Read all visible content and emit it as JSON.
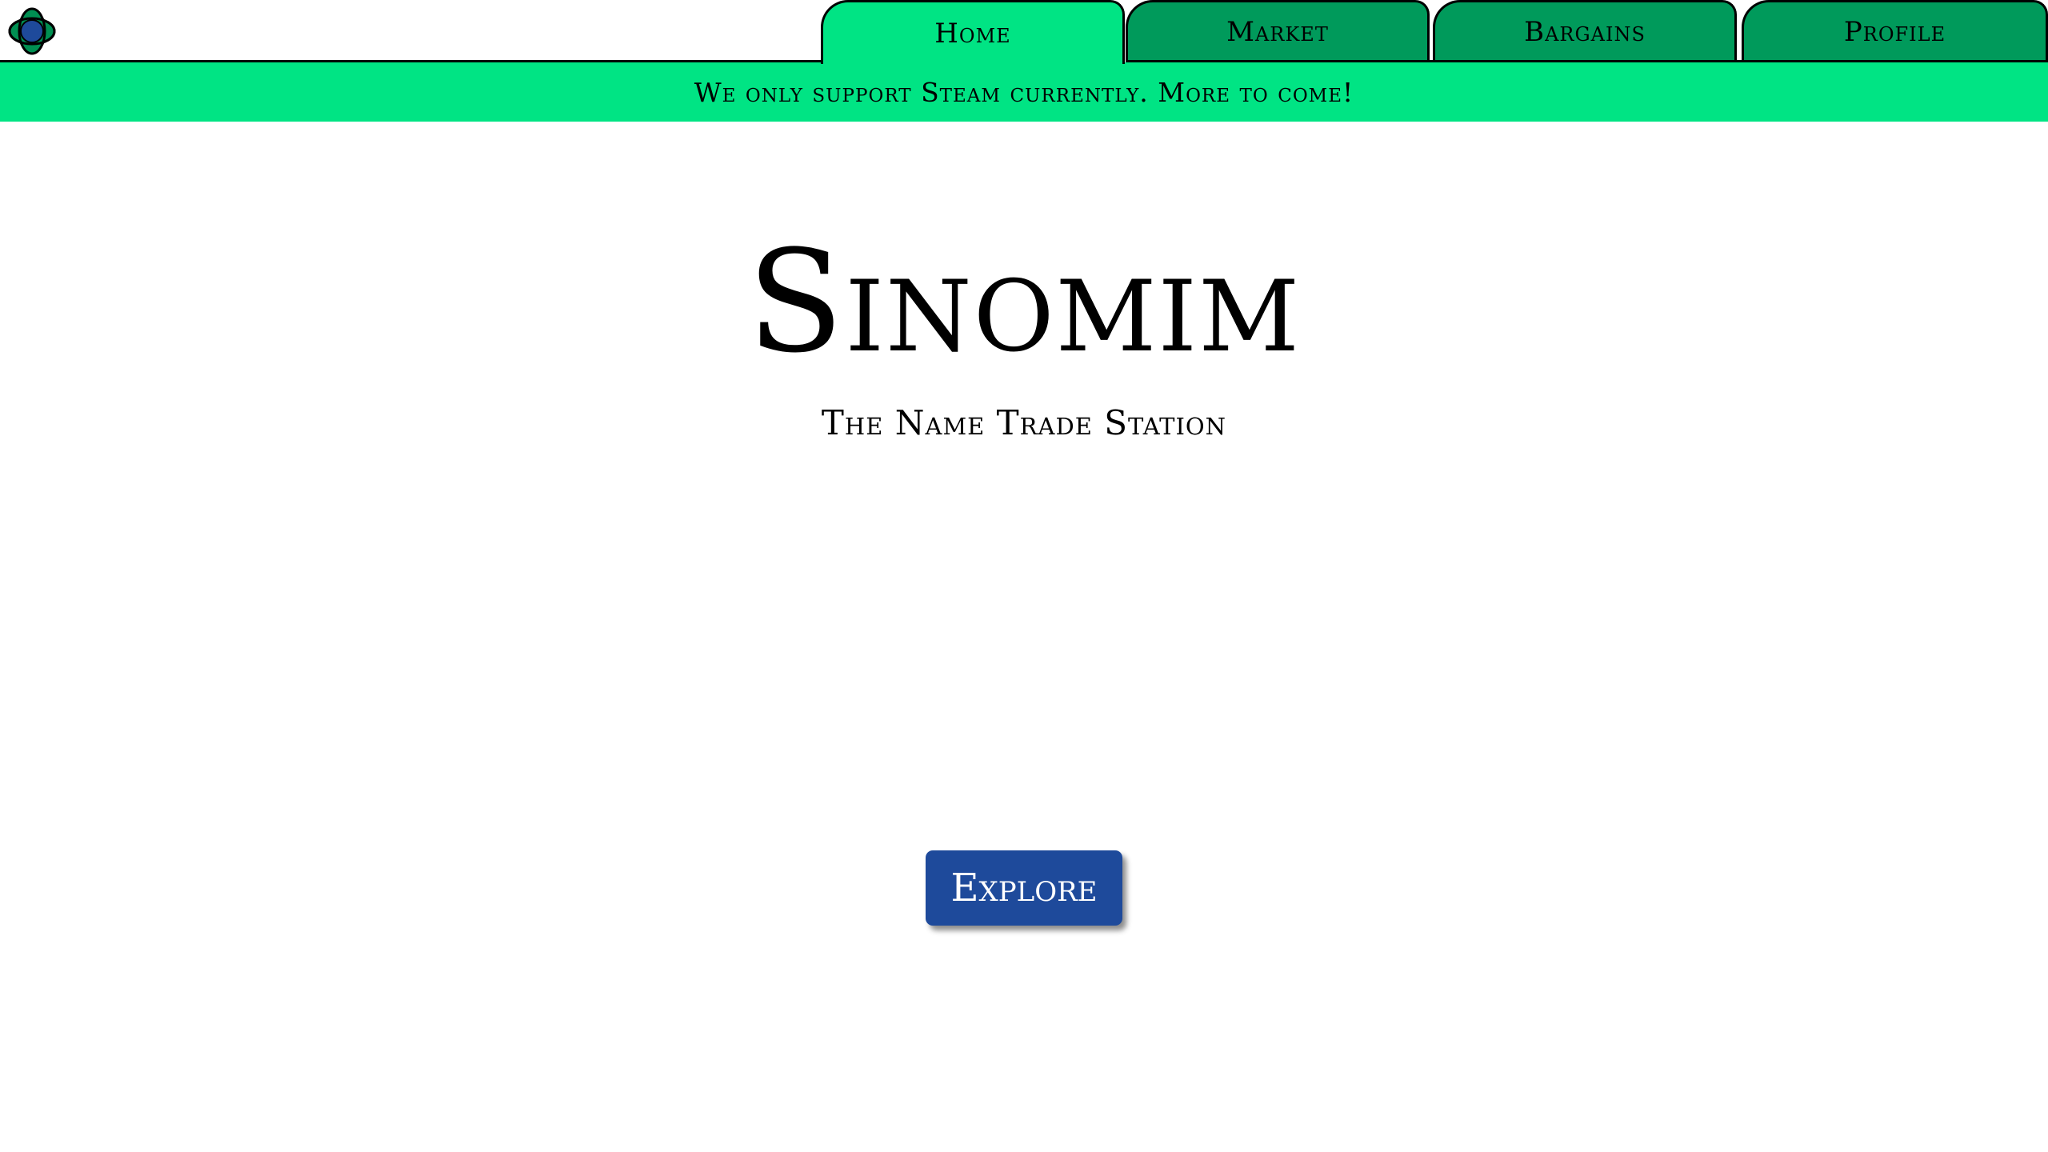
{
  "nav": {
    "tabs": [
      {
        "label": "Home",
        "active": true
      },
      {
        "label": "Market",
        "active": false
      },
      {
        "label": "Bargains",
        "active": false
      },
      {
        "label": "Profile",
        "active": false
      }
    ]
  },
  "banner": {
    "text": "We only support Steam currently. More to come!"
  },
  "hero": {
    "title": "Sinomim",
    "subtitle": "The Name Trade Station",
    "cta_label": "Explore"
  },
  "colors": {
    "active_tab": "#00e484",
    "inactive_tab": "#009a5b",
    "banner": "#00e484",
    "button": "#1e4a9b"
  },
  "icons": {
    "logo": "logo-icon"
  }
}
